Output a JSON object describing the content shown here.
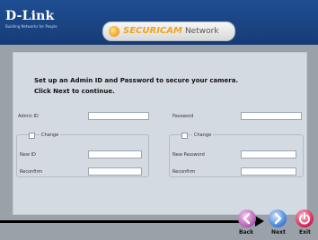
{
  "header": {
    "brand": "D-Link",
    "tagline": "Building Networks for People",
    "product_word1": "SECURICAM",
    "product_word2": "Network"
  },
  "intro": {
    "line1": "Set up an Admin ID and Password to secure your camera.",
    "line2": "Click Next to continue."
  },
  "fields": {
    "admin_id_label": "Admin ID",
    "admin_id_value": "",
    "password_label": "Password",
    "password_value": "",
    "left_change_label": "Change",
    "new_id_label": "New ID",
    "new_id_value": "",
    "reconfirm_left_label": "Reconfirm",
    "reconfirm_left_value": "",
    "right_change_label": "Change",
    "new_password_label": "New Password",
    "new_password_value": "",
    "reconfirm_right_label": "Reconfirm",
    "reconfirm_right_value": ""
  },
  "buttons": {
    "back": "Back",
    "next": "Next",
    "exit": "Exit"
  },
  "colors": {
    "header": "#1f4e92",
    "panel": "#d4dae2",
    "accent": "#f2a21c"
  }
}
